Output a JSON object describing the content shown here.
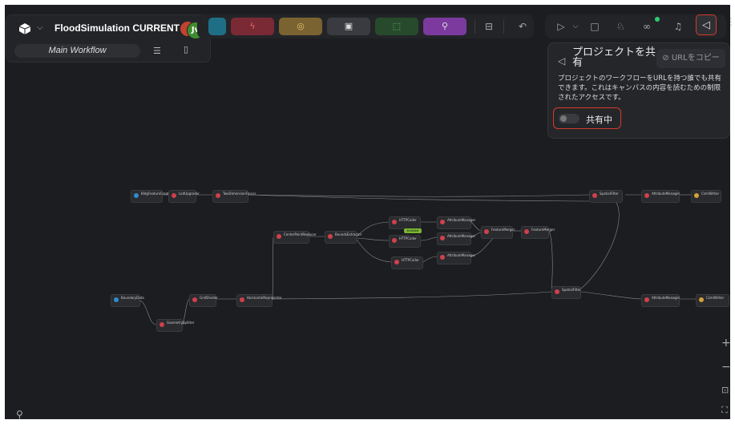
{
  "app": {
    "title": "FloodSimulation CURRENT",
    "avatar_initials": "Jv",
    "workflow_name": "Main Workflow"
  },
  "toolbar": {
    "buttons": [
      {
        "icon": "teal-tool-icon",
        "color": "#1e6f86"
      },
      {
        "icon": "lightning-icon",
        "color": "#7a2a35"
      },
      {
        "icon": "circle-icon",
        "color": "#7a6330"
      },
      {
        "icon": "note-icon",
        "color": "#3a3b40"
      },
      {
        "icon": "dashed-box-icon",
        "color": "#274a2c"
      },
      {
        "icon": "branch-icon",
        "color": "#7c3a9f"
      }
    ],
    "accent_share": "#d33b2c"
  },
  "share_popup": {
    "title": "プロジェクトを共有",
    "copy_label": "URLをコピー",
    "description": "プロジェクトのワークフローをURLを持つ誰でも共有できます。これはキャンバスの内容を読むための制限されたアクセスです。",
    "toggle_label": "共有中",
    "toggle_on": false
  },
  "canvas": {
    "badge": "Enabled 4000",
    "nodes": [
      {
        "id": "n1",
        "label": "BldgFeatureCreator",
        "color": "#2c8bd1"
      },
      {
        "id": "n2",
        "label": "LodUpgrader",
        "color": "#d0404d"
      },
      {
        "id": "n3",
        "label": "TwoDimensionForcer",
        "color": "#d0404d"
      },
      {
        "id": "n4",
        "label": "SpatialFilter",
        "color": "#d0404d"
      },
      {
        "id": "n5",
        "label": "AttributeManager",
        "color": "#d0404d"
      },
      {
        "id": "n6",
        "label": "CzmlWriter",
        "color": "#d4a13a"
      },
      {
        "id": "n7",
        "label": "CenterPointReplacer",
        "color": "#d0404d"
      },
      {
        "id": "n8",
        "label": "BoundsExtractor",
        "color": "#d0404d"
      },
      {
        "id": "n9",
        "label": "HTTPCaller",
        "color": "#d0404d"
      },
      {
        "id": "n10",
        "label": "HTTPCaller",
        "color": "#d0404d"
      },
      {
        "id": "n11",
        "label": "HTTPCaller",
        "color": "#d0404d"
      },
      {
        "id": "n12",
        "label": "AttributeManager",
        "color": "#d0404d"
      },
      {
        "id": "n13",
        "label": "AttributeManager",
        "color": "#d0404d"
      },
      {
        "id": "n14",
        "label": "AttributeManager",
        "color": "#d0404d"
      },
      {
        "id": "n15",
        "label": "FeatureMerger",
        "color": "#d0404d"
      },
      {
        "id": "n16",
        "label": "FeatureMerger",
        "color": "#d0404d"
      },
      {
        "id": "n17",
        "label": "BoundaryData",
        "color": "#2c8bd1"
      },
      {
        "id": "n18",
        "label": "GridDivider",
        "color": "#d0404d"
      },
      {
        "id": "n19",
        "label": "HorizontalReprojector",
        "color": "#d0404d"
      },
      {
        "id": "n20",
        "label": "GeometrySplitter",
        "color": "#d0404d"
      },
      {
        "id": "n21",
        "label": "SpatialFilter",
        "color": "#d0404d"
      },
      {
        "id": "n22",
        "label": "AttributeManager",
        "color": "#d0404d"
      },
      {
        "id": "n23",
        "label": "CzmlWriter",
        "color": "#d4a13a"
      }
    ]
  }
}
